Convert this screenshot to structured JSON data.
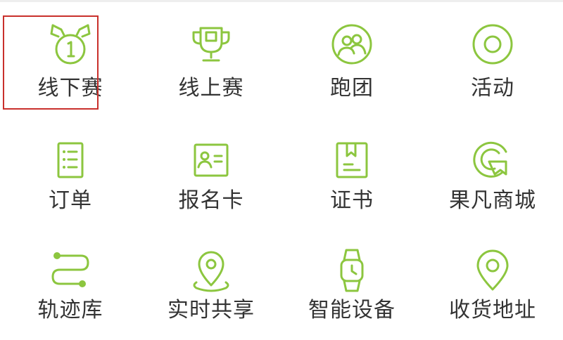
{
  "accent_color": "#8cc63f",
  "selection_color": "#c9302c",
  "selected_item": "线下赛",
  "grid": {
    "items": [
      {
        "label": "线下赛",
        "icon": "medal-icon"
      },
      {
        "label": "线上赛",
        "icon": "trophy-icon"
      },
      {
        "label": "跑团",
        "icon": "group-icon"
      },
      {
        "label": "活动",
        "icon": "target-icon"
      },
      {
        "label": "订单",
        "icon": "order-list-icon"
      },
      {
        "label": "报名卡",
        "icon": "id-card-icon"
      },
      {
        "label": "证书",
        "icon": "certificate-icon"
      },
      {
        "label": "果凡商城",
        "icon": "store-icon"
      },
      {
        "label": "轨迹库",
        "icon": "track-icon"
      },
      {
        "label": "实时共享",
        "icon": "location-share-icon"
      },
      {
        "label": "智能设备",
        "icon": "watch-icon"
      },
      {
        "label": "收货地址",
        "icon": "address-pin-icon"
      }
    ]
  }
}
